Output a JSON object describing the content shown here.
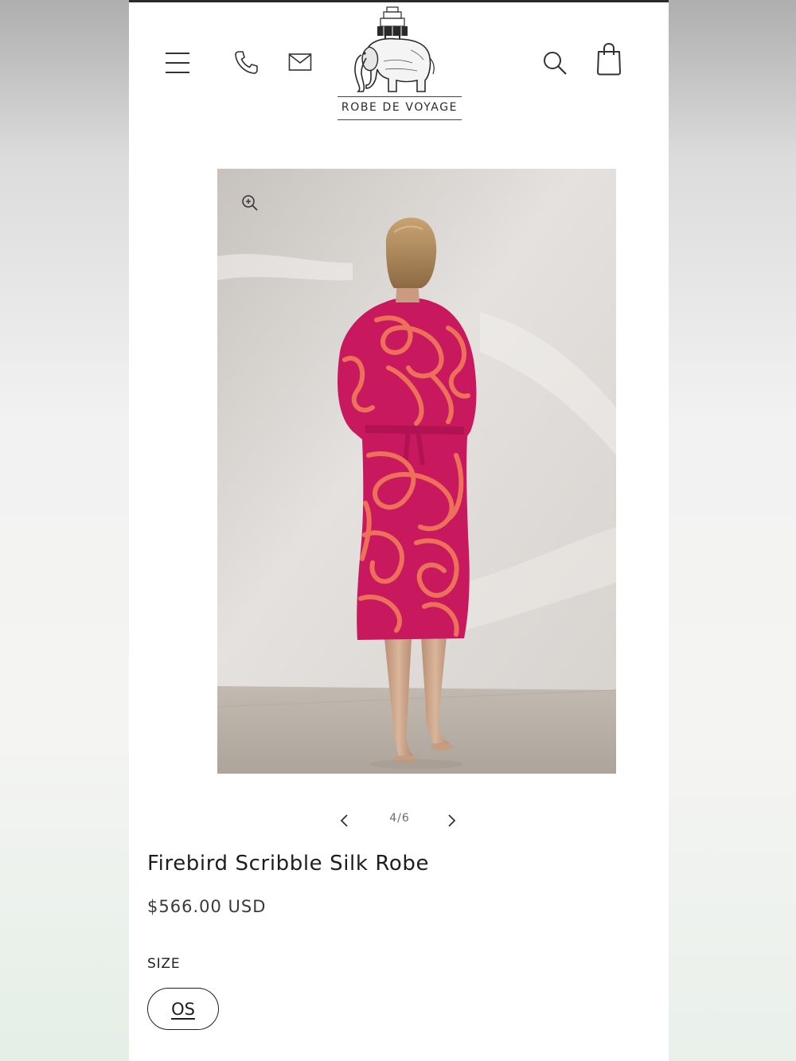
{
  "header": {
    "brand_name": "ROBE DE VOYAGE",
    "icons": [
      "hamburger-menu-icon",
      "phone-icon",
      "mail-icon",
      "search-icon",
      "shopping-bag-icon"
    ]
  },
  "gallery": {
    "current": "4",
    "total": "6",
    "counter_text": "4/6",
    "image_alt": "Model wearing Firebird Scribble Silk Robe, back view"
  },
  "product": {
    "title": "Firebird Scribble Silk Robe",
    "price": "$566.00 USD",
    "size_label": "SIZE",
    "size_options": [
      "OS"
    ],
    "selected_size": "OS"
  },
  "colors": {
    "robe_pink": "#c8195e",
    "robe_pattern": "#f0785a",
    "text_dark": "#1e1e1e"
  }
}
